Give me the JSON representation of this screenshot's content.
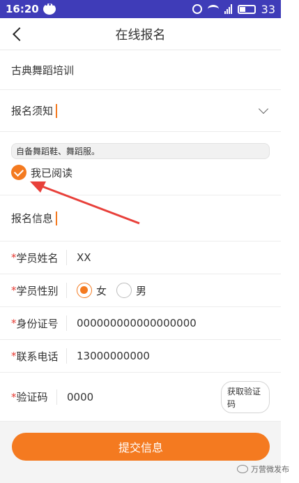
{
  "status": {
    "time": "16:20",
    "battery": "33"
  },
  "header": {
    "title": "在线报名"
  },
  "course": {
    "name": "古典舞蹈培训"
  },
  "notice": {
    "heading": "报名须知",
    "text": "自备舞蹈鞋、舞蹈服。",
    "read_label": "我已阅读"
  },
  "info": {
    "heading": "报名信息"
  },
  "form": {
    "required_mark": "*",
    "name": {
      "label": "学员姓名",
      "value": "XX"
    },
    "gender": {
      "label": "学员性别",
      "option_female": "女",
      "option_male": "男",
      "selected": "女"
    },
    "id": {
      "label": "身份证号",
      "value": "000000000000000000"
    },
    "phone": {
      "label": "联系电话",
      "value": "13000000000"
    },
    "code": {
      "label": "验证码",
      "value": "0000",
      "button": "获取验证码"
    }
  },
  "submit": {
    "label": "提交信息"
  },
  "watermark": {
    "text": "万营微发布"
  },
  "colors": {
    "accent": "#f47a20",
    "statusbar": "#3f3cb8",
    "required": "#e63a32",
    "arrow": "#e8403a"
  }
}
